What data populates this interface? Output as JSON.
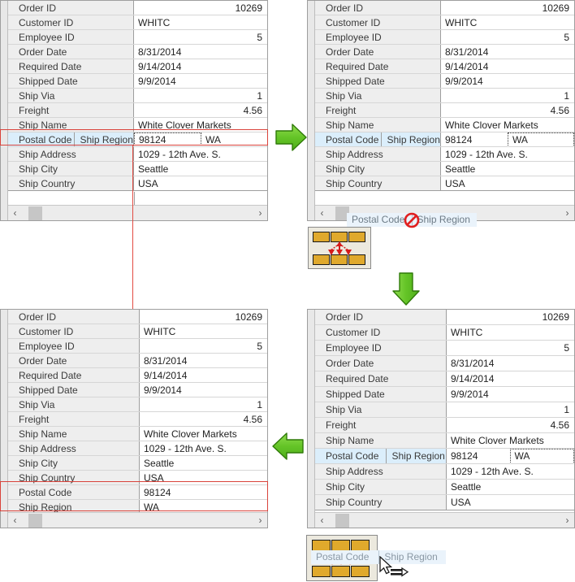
{
  "fields": {
    "order_id": "Order ID",
    "customer_id": "Customer ID",
    "employee_id": "Employee ID",
    "order_date": "Order Date",
    "required_date": "Required Date",
    "shipped_date": "Shipped Date",
    "ship_via": "Ship Via",
    "freight": "Freight",
    "ship_name": "Ship Name",
    "postal_code": "Postal Code",
    "ship_region": "Ship Region",
    "ship_address": "Ship Address",
    "ship_city": "Ship City",
    "ship_country": "Ship Country"
  },
  "values": {
    "order_id": "10269",
    "customer_id": "WHITC",
    "employee_id": "5",
    "order_date": "8/31/2014",
    "required_date": "9/14/2014",
    "shipped_date": "9/9/2014",
    "ship_via": "1",
    "freight": "4.56",
    "ship_name": "White Clover Markets",
    "postal_code": "98124",
    "ship_region": "WA",
    "ship_address": "1029 - 12th Ave. S.",
    "ship_city": "Seattle",
    "ship_country": "USA"
  },
  "scrollbar": {
    "left_arrow": "‹",
    "right_arrow": "›"
  },
  "drag": {
    "ghost_label_1": "Postal Code",
    "ghost_label_2": "Ship Region",
    "no_drop_icon": "no-drop-icon",
    "drag_cursor_icon": "column-drag-icon"
  },
  "flow": {
    "arrow_right": "arrow-right-icon",
    "arrow_down": "arrow-down-icon",
    "arrow_left": "arrow-left-icon"
  },
  "colors": {
    "accent_green": "#6cc328",
    "highlight_red": "#d9433b",
    "selection_blue": "#dbeefb",
    "caption_bg": "#eeeeee",
    "drag_block": "#e0a92c"
  },
  "panels": {
    "top_left": {
      "name": "source-grid-merged-row",
      "rows": [
        "order_id",
        "customer_id",
        "employee_id",
        "order_date",
        "required_date",
        "shipped_date",
        "ship_via",
        "freight",
        "ship_name",
        "__split__",
        "ship_address",
        "ship_city",
        "ship_country"
      ]
    },
    "top_right": {
      "name": "grid-dragging-state",
      "rows": [
        "order_id",
        "customer_id",
        "employee_id",
        "order_date",
        "required_date",
        "shipped_date",
        "ship_via",
        "freight",
        "ship_name",
        "__split__",
        "ship_address",
        "ship_city",
        "ship_country"
      ]
    },
    "bottom_left": {
      "name": "result-grid-unmerged-rows",
      "rows": [
        "order_id",
        "customer_id",
        "employee_id",
        "order_date",
        "required_date",
        "shipped_date",
        "ship_via",
        "freight",
        "ship_name",
        "ship_address",
        "ship_city",
        "ship_country",
        "postal_code",
        "ship_region"
      ]
    },
    "bottom_right": {
      "name": "grid-drop-target-state",
      "rows": [
        "order_id",
        "customer_id",
        "employee_id",
        "order_date",
        "required_date",
        "shipped_date",
        "ship_via",
        "freight",
        "ship_name",
        "__split__",
        "ship_address",
        "ship_city",
        "ship_country"
      ]
    }
  }
}
